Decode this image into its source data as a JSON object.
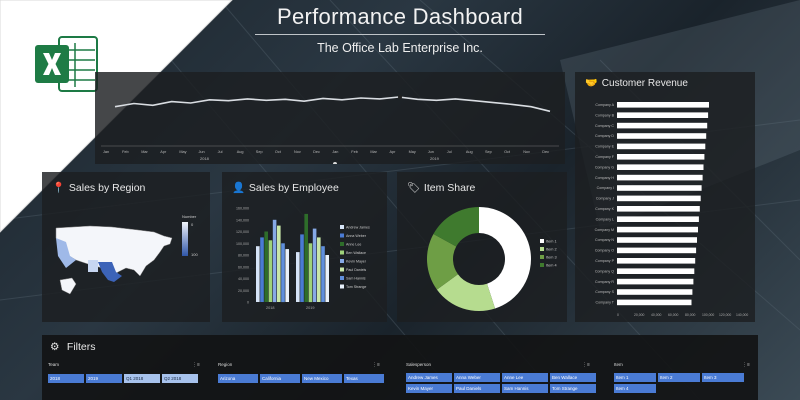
{
  "header": {
    "title": "Performance Dashboard",
    "subtitle": "The Office Lab Enterprise Inc."
  },
  "colors": {
    "accent_blue": "#4a7bd4",
    "green_dark": "#3f7a2e",
    "green_light": "#b6dc8f",
    "panel_bg": "#1c1e21"
  },
  "timeline": {
    "months_2018": [
      "Jan",
      "Feb",
      "Mar",
      "Apr",
      "May",
      "Jun",
      "Jul",
      "Aug",
      "Sep",
      "Oct",
      "Nov",
      "Dec"
    ],
    "months_2019": [
      "Jan",
      "Feb",
      "Mar",
      "Apr",
      "May",
      "Jun",
      "Jul",
      "Aug",
      "Sep",
      "Oct",
      "Nov",
      "Dec"
    ],
    "year_a": "2018",
    "year_b": "2019",
    "values": [
      0.55,
      0.62,
      0.58,
      0.66,
      0.63,
      0.7,
      0.68,
      0.72,
      0.69,
      0.71,
      0.67,
      0.73,
      0.7,
      0.74,
      0.72,
      0.76,
      0.71,
      0.69,
      0.72,
      0.68,
      0.64,
      0.6,
      0.55,
      0.45
    ]
  },
  "customer_revenue": {
    "title": "Customer Revenue",
    "icon": "handshake-icon",
    "companies": [
      "Company A",
      "Company B",
      "Company C",
      "Company D",
      "Company E",
      "Company F",
      "Company G",
      "Company H",
      "Company I",
      "Company J",
      "Company K",
      "Company L",
      "Company M",
      "Company N",
      "Company O",
      "Company P",
      "Company Q",
      "Company R",
      "Company S",
      "Company T"
    ],
    "values": [
      100,
      99,
      98,
      97,
      96,
      95,
      94,
      93,
      92,
      91,
      90,
      89,
      88,
      87,
      86,
      85,
      84,
      83,
      82,
      81
    ],
    "ticks": [
      "0",
      "20,000",
      "40,000",
      "60,000",
      "80,000",
      "100,000",
      "120,000",
      "140,000"
    ]
  },
  "sales_region": {
    "title": "Sales by Region",
    "icon": "map-pin-icon",
    "legend_label": "Number",
    "legend_min": "0",
    "legend_max": "100"
  },
  "sales_employee": {
    "title": "Sales by Employee",
    "icon": "person-icon",
    "y_ticks": [
      "160,000",
      "140,000",
      "120,000",
      "100,000",
      "80,000",
      "60,000",
      "40,000",
      "20,000",
      "0"
    ],
    "years": [
      "2018",
      "2019"
    ],
    "legend": [
      "Andrew James",
      "Anna Weber",
      "Anne Lee",
      "Ben Wallace",
      "Kevin Mayer",
      "Paul Daniels",
      "Sam Hannis",
      "Tom Strange"
    ],
    "values_2018": [
      95000,
      110000,
      120000,
      105000,
      140000,
      130000,
      100000,
      90000
    ],
    "values_2019": [
      85000,
      115000,
      150000,
      100000,
      125000,
      110000,
      95000,
      80000
    ]
  },
  "item_share": {
    "title": "Item Share",
    "icon": "tag-icon",
    "legend": [
      "Item 1",
      "Item 2",
      "Item 3",
      "Item 4"
    ],
    "values": [
      45,
      20,
      18,
      17
    ]
  },
  "filters": {
    "title": "Filters",
    "icon": "gear-icon",
    "team_label": "Team",
    "team_chips": [
      "2018",
      "2019",
      "Q1 2018",
      "Q2 2018"
    ],
    "region_label": "Region",
    "region_chips": [
      "Arizona",
      "California",
      "New Mexico",
      "Texas"
    ],
    "salesperson_label": "Salesperson",
    "salesperson_chips": [
      "Andrew James",
      "Anna Weber",
      "Anne Lee",
      "Ben Wallace",
      "Kevin Mayer",
      "Paul Daniels",
      "Sam Hannis",
      "Tom Strange"
    ],
    "item_label": "Item",
    "item_chips": [
      "Item 1",
      "Item 2",
      "Item 3",
      "Item 4"
    ]
  }
}
